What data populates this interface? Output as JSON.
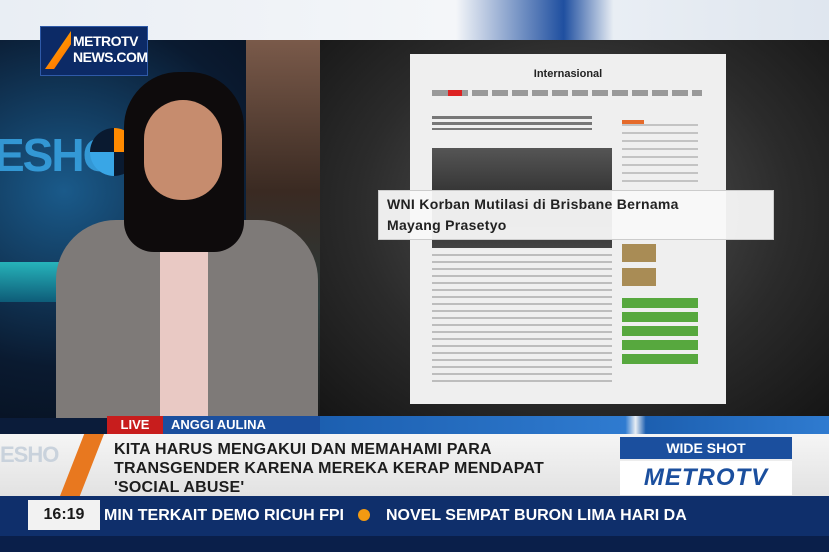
{
  "channel_logo": {
    "line1": "METROTV",
    "line2": "NEWS.COM"
  },
  "studio_backdrop_text": "ESHO",
  "web_page": {
    "section_title": "Internasional"
  },
  "headline_overlay": {
    "line1": "WNI Korban Mutilasi di Brisbane Bernama",
    "line2": "Mayang Prasetyo"
  },
  "live_tag": "LIVE",
  "presenter_name": "ANGGI AULINA",
  "lower_third_logo_text": "ESHO",
  "caption": {
    "line1": "KITA HARUS MENGAKUI DAN MEMAHAMI PARA",
    "line2": "TRANSGENDER KARENA MEREKA KERAP MENDAPAT",
    "line3": "'SOCIAL ABUSE'"
  },
  "program_tag": "WIDE SHOT",
  "brand": "METROTV",
  "clock": "16:19",
  "ticker": {
    "item1": "MIN TERKAIT DEMO RICUH FPI",
    "item2": "NOVEL SEMPAT BURON LIMA HARI DA"
  },
  "colors": {
    "live_red": "#c81d1d",
    "metro_blue": "#1b4f9e",
    "accent_orange": "#e8781f",
    "ticker_navy": "#0f2f6b"
  }
}
